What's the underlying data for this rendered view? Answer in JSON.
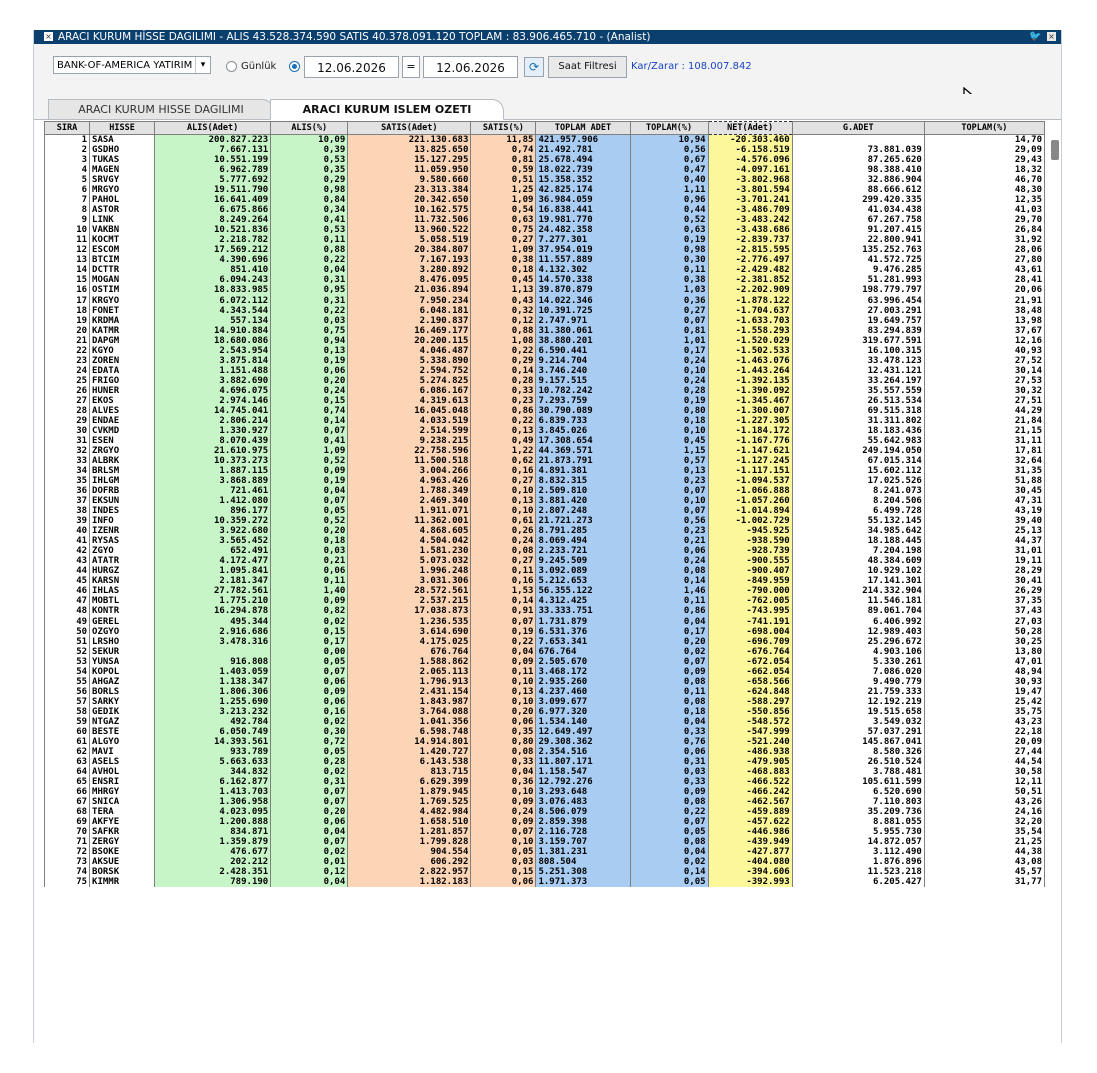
{
  "window": {
    "title": "ARACI KURUM HİSSE DAGILIMI - ALIS 43.528.374.590  SATIS 40.378.091.120  TOPLAM : 83.906.465.710 - (Analist)"
  },
  "toolbar": {
    "broker_select": "BANK-OF-AMERICA YATIRIM",
    "radio_daily": "Günlük",
    "date_from": "12.06.2026",
    "equals": "=",
    "date_to": "12.06.2026",
    "time_filter_button": "Saat Filtresi",
    "profit_loss": "Kar/Zarar : 108.007.842"
  },
  "tabs": [
    {
      "label": "ARACI KURUM HISSE DAGILIMI",
      "active": false
    },
    {
      "label": "ARACI KURUM ISLEM OZETI",
      "active": true
    }
  ],
  "columns": [
    "SIRA",
    "HISSE",
    "ALIS(Adet)",
    "ALIS(%)",
    "SATIS(Adet)",
    "SATIS(%)",
    "TOPLAM ADET",
    "TOPLAM(%)",
    "NET(Adet)",
    "G.ADET",
    "TOPLAM(%)"
  ],
  "rows": [
    [
      "1",
      "SASA",
      "200.827.223",
      "10,09",
      "221.130.683",
      "11,85",
      "421.957.906",
      "10,94",
      "-20.303.460",
      "",
      "14,70"
    ],
    [
      "2",
      "GSDHO",
      "7.667.131",
      "0,39",
      "13.825.650",
      "0,74",
      "21.492.781",
      "0,56",
      "-6.158.519",
      "73.881.039",
      "29,09"
    ],
    [
      "3",
      "TUKAS",
      "10.551.199",
      "0,53",
      "15.127.295",
      "0,81",
      "25.678.494",
      "0,67",
      "-4.576.096",
      "87.265.620",
      "29,43"
    ],
    [
      "4",
      "MAGEN",
      "6.962.789",
      "0,35",
      "11.059.950",
      "0,59",
      "18.022.739",
      "0,47",
      "-4.097.161",
      "98.388.410",
      "18,32"
    ],
    [
      "5",
      "SRVGY",
      "5.777.692",
      "0,29",
      "9.580.660",
      "0,51",
      "15.358.352",
      "0,40",
      "-3.802.968",
      "32.886.904",
      "46,70"
    ],
    [
      "6",
      "MRGYO",
      "19.511.790",
      "0,98",
      "23.313.384",
      "1,25",
      "42.825.174",
      "1,11",
      "-3.801.594",
      "88.666.612",
      "48,30"
    ],
    [
      "7",
      "PAHOL",
      "16.641.409",
      "0,84",
      "20.342.650",
      "1,09",
      "36.984.059",
      "0,96",
      "-3.701.241",
      "299.420.335",
      "12,35"
    ],
    [
      "8",
      "ASTOR",
      "6.675.866",
      "0,34",
      "10.162.575",
      "0,54",
      "16.838.441",
      "0,44",
      "-3.486.709",
      "41.034.438",
      "41,03"
    ],
    [
      "9",
      "LINK",
      "8.249.264",
      "0,41",
      "11.732.506",
      "0,63",
      "19.981.770",
      "0,52",
      "-3.483.242",
      "67.267.758",
      "29,70"
    ],
    [
      "10",
      "VAKBN",
      "10.521.836",
      "0,53",
      "13.960.522",
      "0,75",
      "24.482.358",
      "0,63",
      "-3.438.686",
      "91.207.415",
      "26,84"
    ],
    [
      "11",
      "KOCMT",
      "2.218.782",
      "0,11",
      "5.058.519",
      "0,27",
      "7.277.301",
      "0,19",
      "-2.839.737",
      "22.800.941",
      "31,92"
    ],
    [
      "12",
      "ESCOM",
      "17.569.212",
      "0,88",
      "20.384.807",
      "1,09",
      "37.954.019",
      "0,98",
      "-2.815.595",
      "135.252.763",
      "28,06"
    ],
    [
      "13",
      "BTCIM",
      "4.390.696",
      "0,22",
      "7.167.193",
      "0,38",
      "11.557.889",
      "0,30",
      "-2.776.497",
      "41.572.725",
      "27,80"
    ],
    [
      "14",
      "DCTTR",
      "851.410",
      "0,04",
      "3.280.892",
      "0,18",
      "4.132.302",
      "0,11",
      "-2.429.482",
      "9.476.285",
      "43,61"
    ],
    [
      "15",
      "MOGAN",
      "6.094.243",
      "0,31",
      "8.476.095",
      "0,45",
      "14.570.338",
      "0,38",
      "-2.381.852",
      "51.281.993",
      "28,41"
    ],
    [
      "16",
      "OSTIM",
      "18.833.985",
      "0,95",
      "21.036.894",
      "1,13",
      "39.870.879",
      "1,03",
      "-2.202.909",
      "198.779.797",
      "20,06"
    ],
    [
      "17",
      "KRGYO",
      "6.072.112",
      "0,31",
      "7.950.234",
      "0,43",
      "14.022.346",
      "0,36",
      "-1.878.122",
      "63.996.454",
      "21,91"
    ],
    [
      "18",
      "FONET",
      "4.343.544",
      "0,22",
      "6.048.181",
      "0,32",
      "10.391.725",
      "0,27",
      "-1.704.637",
      "27.003.291",
      "38,48"
    ],
    [
      "19",
      "KRDMA",
      "557.134",
      "0,03",
      "2.190.837",
      "0,12",
      "2.747.971",
      "0,07",
      "-1.633.703",
      "19.649.757",
      "13,98"
    ],
    [
      "20",
      "KATMR",
      "14.910.884",
      "0,75",
      "16.469.177",
      "0,88",
      "31.380.061",
      "0,81",
      "-1.558.293",
      "83.294.839",
      "37,67"
    ],
    [
      "21",
      "DAPGM",
      "18.680.086",
      "0,94",
      "20.200.115",
      "1,08",
      "38.880.201",
      "1,01",
      "-1.520.029",
      "319.677.591",
      "12,16"
    ],
    [
      "22",
      "KGYO",
      "2.543.954",
      "0,13",
      "4.046.487",
      "0,22",
      "6.590.441",
      "0,17",
      "-1.502.533",
      "16.100.315",
      "40,93"
    ],
    [
      "23",
      "ZOREN",
      "3.875.814",
      "0,19",
      "5.338.890",
      "0,29",
      "9.214.704",
      "0,24",
      "-1.463.076",
      "33.478.123",
      "27,52"
    ],
    [
      "24",
      "EDATA",
      "1.151.488",
      "0,06",
      "2.594.752",
      "0,14",
      "3.746.240",
      "0,10",
      "-1.443.264",
      "12.431.121",
      "30,14"
    ],
    [
      "25",
      "FRIGO",
      "3.882.690",
      "0,20",
      "5.274.825",
      "0,28",
      "9.157.515",
      "0,24",
      "-1.392.135",
      "33.264.197",
      "27,53"
    ],
    [
      "26",
      "HUNER",
      "4.696.075",
      "0,24",
      "6.086.167",
      "0,33",
      "10.782.242",
      "0,28",
      "-1.390.092",
      "35.557.559",
      "30,32"
    ],
    [
      "27",
      "EKOS",
      "2.974.146",
      "0,15",
      "4.319.613",
      "0,23",
      "7.293.759",
      "0,19",
      "-1.345.467",
      "26.513.534",
      "27,51"
    ],
    [
      "28",
      "ALVES",
      "14.745.041",
      "0,74",
      "16.045.048",
      "0,86",
      "30.790.089",
      "0,80",
      "-1.300.007",
      "69.515.318",
      "44,29"
    ],
    [
      "29",
      "ENDAE",
      "2.806.214",
      "0,14",
      "4.033.519",
      "0,22",
      "6.839.733",
      "0,18",
      "-1.227.305",
      "31.311.802",
      "21,84"
    ],
    [
      "30",
      "CVKMD",
      "1.330.927",
      "0,07",
      "2.514.599",
      "0,13",
      "3.845.026",
      "0,10",
      "-1.184.172",
      "18.183.436",
      "21,15"
    ],
    [
      "31",
      "ESEN",
      "8.070.439",
      "0,41",
      "9.238.215",
      "0,49",
      "17.308.654",
      "0,45",
      "-1.167.776",
      "55.642.983",
      "31,11"
    ],
    [
      "32",
      "ZRGYO",
      "21.610.975",
      "1,09",
      "22.758.596",
      "1,22",
      "44.369.571",
      "1,15",
      "-1.147.621",
      "249.194.050",
      "17,81"
    ],
    [
      "33",
      "ALBRK",
      "10.373.273",
      "0,52",
      "11.500.518",
      "0,62",
      "21.873.791",
      "0,57",
      "-1.127.245",
      "67.015.314",
      "32,64"
    ],
    [
      "34",
      "BRLSM",
      "1.887.115",
      "0,09",
      "3.004.266",
      "0,16",
      "4.891.381",
      "0,13",
      "-1.117.151",
      "15.602.112",
      "31,35"
    ],
    [
      "35",
      "IHLGM",
      "3.868.889",
      "0,19",
      "4.963.426",
      "0,27",
      "8.832.315",
      "0,23",
      "-1.094.537",
      "17.025.526",
      "51,88"
    ],
    [
      "36",
      "DOFRB",
      "721.461",
      "0,04",
      "1.788.349",
      "0,10",
      "2.509.810",
      "0,07",
      "-1.066.888",
      "8.241.073",
      "30,45"
    ],
    [
      "37",
      "EKSUN",
      "1.412.080",
      "0,07",
      "2.469.340",
      "0,13",
      "3.881.420",
      "0,10",
      "-1.057.260",
      "8.204.506",
      "47,31"
    ],
    [
      "38",
      "INDES",
      "896.177",
      "0,05",
      "1.911.071",
      "0,10",
      "2.807.248",
      "0,07",
      "-1.014.894",
      "6.499.728",
      "43,19"
    ],
    [
      "39",
      "INFO",
      "10.359.272",
      "0,52",
      "11.362.001",
      "0,61",
      "21.721.273",
      "0,56",
      "-1.002.729",
      "55.132.145",
      "39,40"
    ],
    [
      "40",
      "IZENR",
      "3.922.680",
      "0,20",
      "4.868.605",
      "0,26",
      "8.791.285",
      "0,23",
      "-945.925",
      "34.985.642",
      "25,13"
    ],
    [
      "41",
      "RYSAS",
      "3.565.452",
      "0,18",
      "4.504.042",
      "0,24",
      "8.069.494",
      "0,21",
      "-938.590",
      "18.188.445",
      "44,37"
    ],
    [
      "42",
      "ZGYO",
      "652.491",
      "0,03",
      "1.581.230",
      "0,08",
      "2.233.721",
      "0,06",
      "-928.739",
      "7.204.198",
      "31,01"
    ],
    [
      "43",
      "ATATR",
      "4.172.477",
      "0,21",
      "5.073.032",
      "0,27",
      "9.245.509",
      "0,24",
      "-900.555",
      "48.384.609",
      "19,11"
    ],
    [
      "44",
      "HURGZ",
      "1.095.841",
      "0,06",
      "1.996.248",
      "0,11",
      "3.092.089",
      "0,08",
      "-900.407",
      "10.929.102",
      "28,29"
    ],
    [
      "45",
      "KARSN",
      "2.181.347",
      "0,11",
      "3.031.306",
      "0,16",
      "5.212.653",
      "0,14",
      "-849.959",
      "17.141.301",
      "30,41"
    ],
    [
      "46",
      "IHLAS",
      "27.782.561",
      "1,40",
      "28.572.561",
      "1,53",
      "56.355.122",
      "1,46",
      "-790.000",
      "214.332.904",
      "26,29"
    ],
    [
      "47",
      "MOBTL",
      "1.775.210",
      "0,09",
      "2.537.215",
      "0,14",
      "4.312.425",
      "0,11",
      "-762.005",
      "11.546.181",
      "37,35"
    ],
    [
      "48",
      "KONTR",
      "16.294.878",
      "0,82",
      "17.038.873",
      "0,91",
      "33.333.751",
      "0,86",
      "-743.995",
      "89.061.704",
      "37,43"
    ],
    [
      "49",
      "GEREL",
      "495.344",
      "0,02",
      "1.236.535",
      "0,07",
      "1.731.879",
      "0,04",
      "-741.191",
      "6.406.992",
      "27,03"
    ],
    [
      "50",
      "OZGYO",
      "2.916.686",
      "0,15",
      "3.614.690",
      "0,19",
      "6.531.376",
      "0,17",
      "-698.004",
      "12.989.403",
      "50,28"
    ],
    [
      "51",
      "LRSHO",
      "3.478.316",
      "0,17",
      "4.175.025",
      "0,22",
      "7.653.341",
      "0,20",
      "-696.709",
      "25.296.672",
      "30,25"
    ],
    [
      "52",
      "SEKUR",
      "",
      "0,00",
      "676.764",
      "0,04",
      "676.764",
      "0,02",
      "-676.764",
      "4.903.106",
      "13,80"
    ],
    [
      "53",
      "YUNSA",
      "916.808",
      "0,05",
      "1.588.862",
      "0,09",
      "2.505.670",
      "0,07",
      "-672.054",
      "5.330.261",
      "47,01"
    ],
    [
      "54",
      "KOPOL",
      "1.403.059",
      "0,07",
      "2.065.113",
      "0,11",
      "3.468.172",
      "0,09",
      "-662.054",
      "7.086.020",
      "48,94"
    ],
    [
      "55",
      "AHGAZ",
      "1.138.347",
      "0,06",
      "1.796.913",
      "0,10",
      "2.935.260",
      "0,08",
      "-658.566",
      "9.490.779",
      "30,93"
    ],
    [
      "56",
      "BORLS",
      "1.806.306",
      "0,09",
      "2.431.154",
      "0,13",
      "4.237.460",
      "0,11",
      "-624.848",
      "21.759.333",
      "19,47"
    ],
    [
      "57",
      "SARKY",
      "1.255.690",
      "0,06",
      "1.843.987",
      "0,10",
      "3.099.677",
      "0,08",
      "-588.297",
      "12.192.219",
      "25,42"
    ],
    [
      "58",
      "GEDIK",
      "3.213.232",
      "0,16",
      "3.764.088",
      "0,20",
      "6.977.320",
      "0,18",
      "-550.856",
      "19.515.658",
      "35,75"
    ],
    [
      "59",
      "NTGAZ",
      "492.784",
      "0,02",
      "1.041.356",
      "0,06",
      "1.534.140",
      "0,04",
      "-548.572",
      "3.549.032",
      "43,23"
    ],
    [
      "60",
      "BESTE",
      "6.050.749",
      "0,30",
      "6.598.748",
      "0,35",
      "12.649.497",
      "0,33",
      "-547.999",
      "57.037.291",
      "22,18"
    ],
    [
      "61",
      "ALGYO",
      "14.393.561",
      "0,72",
      "14.914.801",
      "0,80",
      "29.308.362",
      "0,76",
      "-521.240",
      "145.867.041",
      "20,09"
    ],
    [
      "62",
      "MAVI",
      "933.789",
      "0,05",
      "1.420.727",
      "0,08",
      "2.354.516",
      "0,06",
      "-486.938",
      "8.580.326",
      "27,44"
    ],
    [
      "63",
      "ASELS",
      "5.663.633",
      "0,28",
      "6.143.538",
      "0,33",
      "11.807.171",
      "0,31",
      "-479.905",
      "26.510.524",
      "44,54"
    ],
    [
      "64",
      "AVHOL",
      "344.832",
      "0,02",
      "813.715",
      "0,04",
      "1.158.547",
      "0,03",
      "-468.883",
      "3.788.481",
      "30,58"
    ],
    [
      "65",
      "ENSRI",
      "6.162.877",
      "0,31",
      "6.629.399",
      "0,36",
      "12.792.276",
      "0,33",
      "-466.522",
      "105.611.599",
      "12,11"
    ],
    [
      "66",
      "MHRGY",
      "1.413.703",
      "0,07",
      "1.879.945",
      "0,10",
      "3.293.648",
      "0,09",
      "-466.242",
      "6.520.690",
      "50,51"
    ],
    [
      "67",
      "SNICA",
      "1.306.958",
      "0,07",
      "1.769.525",
      "0,09",
      "3.076.483",
      "0,08",
      "-462.567",
      "7.110.803",
      "43,26"
    ],
    [
      "68",
      "TERA",
      "4.023.095",
      "0,20",
      "4.482.984",
      "0,24",
      "8.506.079",
      "0,22",
      "-459.889",
      "35.209.736",
      "24,16"
    ],
    [
      "69",
      "AKFYE",
      "1.200.888",
      "0,06",
      "1.658.510",
      "0,09",
      "2.859.398",
      "0,07",
      "-457.622",
      "8.881.055",
      "32,20"
    ],
    [
      "70",
      "SAFKR",
      "834.871",
      "0,04",
      "1.281.857",
      "0,07",
      "2.116.728",
      "0,05",
      "-446.986",
      "5.955.730",
      "35,54"
    ],
    [
      "71",
      "ZERGY",
      "1.359.879",
      "0,07",
      "1.799.828",
      "0,10",
      "3.159.707",
      "0,08",
      "-439.949",
      "14.872.057",
      "21,25"
    ],
    [
      "72",
      "BSOKE",
      "476.677",
      "0,02",
      "904.554",
      "0,05",
      "1.381.231",
      "0,04",
      "-427.877",
      "3.112.490",
      "44,38"
    ],
    [
      "73",
      "AKSUE",
      "202.212",
      "0,01",
      "606.292",
      "0,03",
      "808.504",
      "0,02",
      "-404.080",
      "1.876.896",
      "43,08"
    ],
    [
      "74",
      "BORSK",
      "2.428.351",
      "0,12",
      "2.822.957",
      "0,15",
      "5.251.308",
      "0,14",
      "-394.606",
      "11.523.218",
      "45,57"
    ],
    [
      "75",
      "KIMMR",
      "789.190",
      "0,04",
      "1.182.183",
      "0,06",
      "1.971.373",
      "0,05",
      "-392.993",
      "6.205.427",
      "31,77"
    ]
  ]
}
